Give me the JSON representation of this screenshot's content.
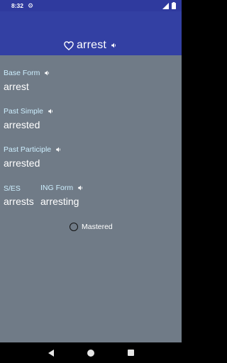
{
  "status": {
    "time": "8:32"
  },
  "header": {
    "word": "arrest"
  },
  "forms": {
    "base": {
      "label": "Base Form",
      "value": "arrest"
    },
    "past_simple": {
      "label": "Past Simple",
      "value": "arrested"
    },
    "past_participle": {
      "label": "Past Participle",
      "value": "arrested"
    },
    "ses": {
      "label": "S/ES",
      "value": "arrests"
    },
    "ing": {
      "label": "ING Form",
      "value": "arresting"
    }
  },
  "mastered": {
    "label": "Mastered",
    "checked": false
  },
  "colors": {
    "status_bar": "#2f3a9e",
    "app_bar": "#3340a3",
    "background": "#707b87",
    "label": "#cdefff"
  }
}
